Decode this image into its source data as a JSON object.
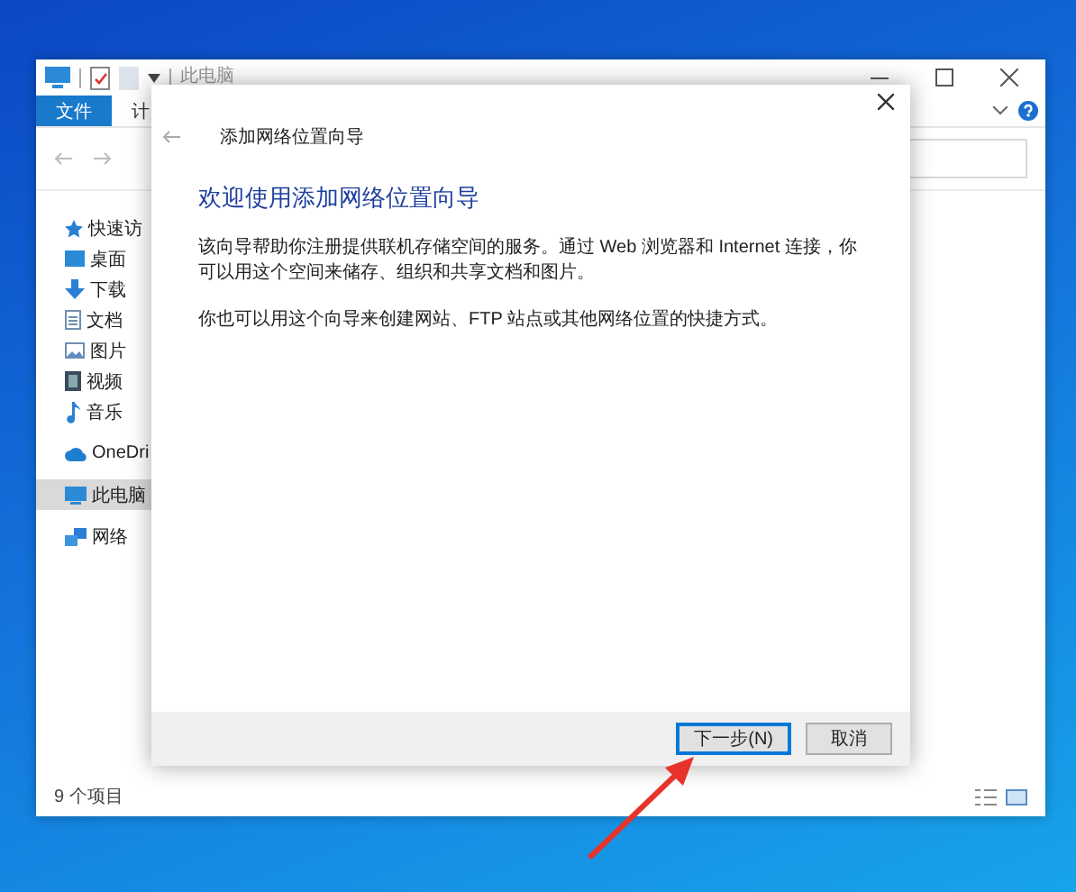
{
  "explorer": {
    "title": "此电脑",
    "ribbon_tabs": [
      {
        "label": "文件",
        "selected": true
      },
      {
        "label": "计",
        "selected": false
      }
    ],
    "sidebar": {
      "sections": [
        {
          "items": [
            {
              "label": "快速访",
              "kind": "star",
              "selected": false
            },
            {
              "label": "桌面",
              "kind": "desktop",
              "selected": false
            },
            {
              "label": "下载",
              "kind": "download",
              "selected": false
            },
            {
              "label": "文档",
              "kind": "document",
              "selected": false
            },
            {
              "label": "图片",
              "kind": "pictures",
              "selected": false
            },
            {
              "label": "视频",
              "kind": "video",
              "selected": false
            },
            {
              "label": "音乐",
              "kind": "music",
              "selected": false
            }
          ]
        },
        {
          "items": [
            {
              "label": "OneDri",
              "kind": "cloud",
              "selected": false
            }
          ]
        },
        {
          "items": [
            {
              "label": "此电脑",
              "kind": "computer",
              "selected": true
            }
          ]
        },
        {
          "items": [
            {
              "label": "网络",
              "kind": "network",
              "selected": false
            }
          ]
        }
      ]
    },
    "status_bar": "9 个项目"
  },
  "dialog": {
    "header": "添加网络位置向导",
    "heading": "欢迎使用添加网络位置向导",
    "paragraphs": [
      "该向导帮助你注册提供联机存储空间的服务。通过 Web 浏览器和 Internet 连接，你可以用这个空间来储存、组织和共享文档和图片。",
      "你也可以用这个向导来创建网站、FTP 站点或其他网络位置的快捷方式。"
    ],
    "buttons": [
      {
        "label": "下一步(N)",
        "focused": true
      },
      {
        "label": "取消",
        "focused": false
      }
    ]
  }
}
